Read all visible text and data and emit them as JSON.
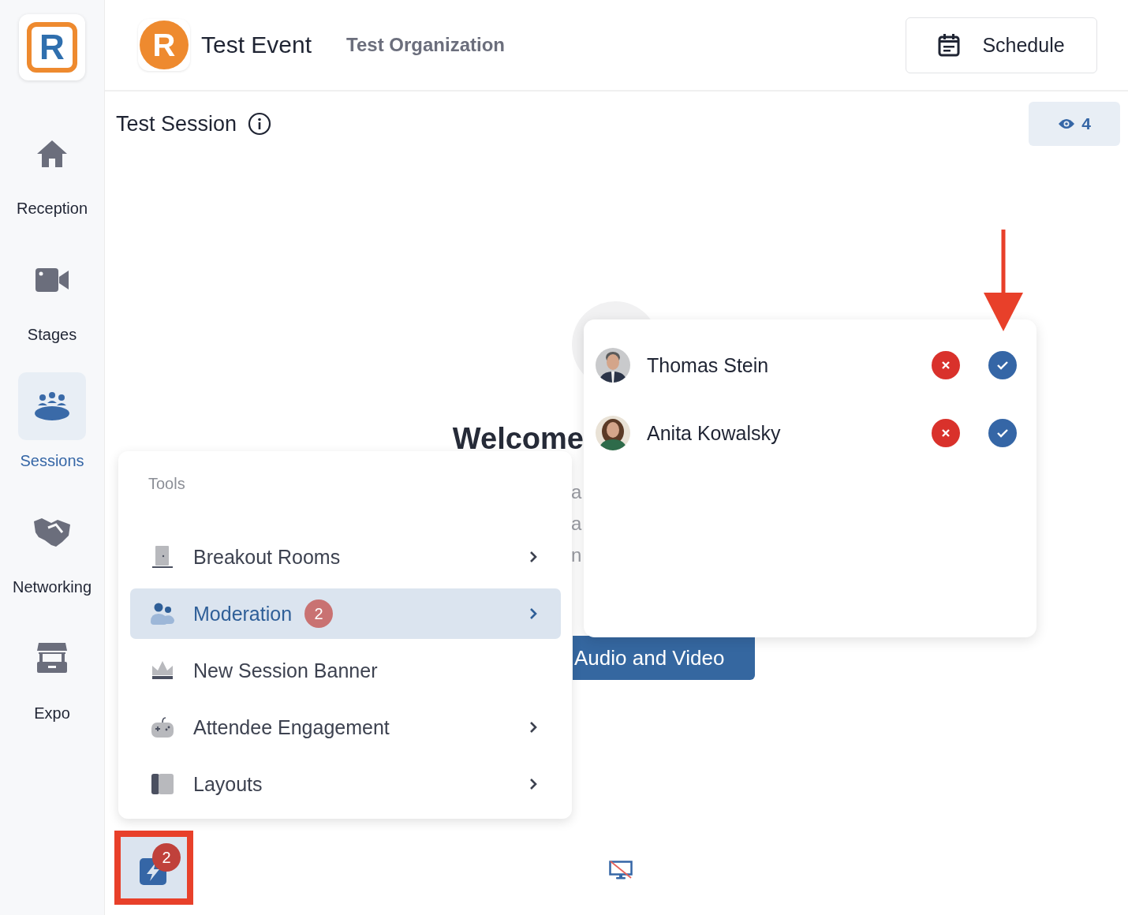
{
  "sidebar": {
    "logo_letter": "R",
    "items": [
      {
        "label": "Reception",
        "kind": "home",
        "selected": false
      },
      {
        "label": "Stages",
        "kind": "camera",
        "selected": false
      },
      {
        "label": "Sessions",
        "kind": "group",
        "selected": true
      },
      {
        "label": "Networking",
        "kind": "handshake",
        "selected": false
      },
      {
        "label": "Expo",
        "kind": "booth",
        "selected": false
      }
    ]
  },
  "header": {
    "logo_letter": "R",
    "event_title": "Test Event",
    "organization": "Test Organization",
    "schedule_button": "Schedule"
  },
  "session": {
    "title": "Test Session",
    "viewer_count": "4"
  },
  "stage": {
    "heading": "Welcome",
    "partial_lines": [
      "a",
      "a",
      "n"
    ],
    "button": "Audio and Video"
  },
  "tools_menu": {
    "title": "Tools",
    "items": [
      {
        "label": "Breakout Rooms",
        "kind": "door",
        "submenu": true,
        "selected": false
      },
      {
        "label": "Moderation",
        "kind": "people",
        "submenu": true,
        "selected": true,
        "badge": "2"
      },
      {
        "label": "New Session Banner",
        "kind": "crown",
        "submenu": false,
        "selected": false
      },
      {
        "label": "Attendee Engagement",
        "kind": "gamepad",
        "submenu": true,
        "selected": false
      },
      {
        "label": "Layouts",
        "kind": "layout",
        "submenu": true,
        "selected": false
      }
    ]
  },
  "moderation_requests": [
    {
      "name": "Thomas Stein",
      "kind": "man"
    },
    {
      "name": "Anita Kowalsky",
      "kind": "woman"
    }
  ],
  "tools_button": {
    "badge": "2",
    "highlighted": true
  },
  "screen_share": {
    "on": false
  }
}
